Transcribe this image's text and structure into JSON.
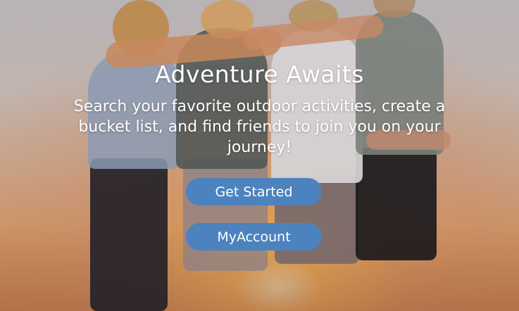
{
  "hero": {
    "title": "Adventure Awaits",
    "subtitle": "Search your favorite outdoor activities, create a bucket list, and find friends to join you on your journey!"
  },
  "buttons": {
    "get_started": "Get Started",
    "my_account": "MyAccount"
  },
  "colors": {
    "button_bg": "#4c82bd",
    "text": "#ffffff"
  }
}
